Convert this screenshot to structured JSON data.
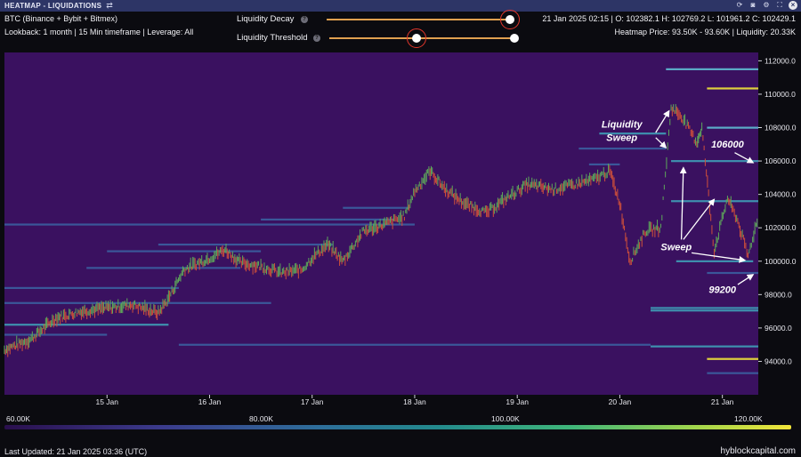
{
  "window": {
    "title": "HEATMAP - LIQUIDATIONS",
    "icons": [
      "swap-icon",
      "refresh-icon",
      "camera-icon",
      "settings-icon",
      "fullscreen-icon",
      "close-icon"
    ]
  },
  "header": {
    "exchange": "BTC (Binance + Bybit + Bitmex)",
    "lookback": "Lookback: 1 month | 15 Min timeframe | Leverage: All",
    "ohlc": "21 Jan 2025 02:15 | O: 102382.1 H: 102769.2 L: 101961.2 C: 102429.1",
    "heatmap_info": "Heatmap Price: 93.50K - 93.60K | Liquidity: 20.33K"
  },
  "controls": {
    "decay_label": "Liquidity Decay",
    "threshold_label": "Liquidity Threshold",
    "decay_value": 0.98,
    "threshold_range": [
      0.48,
      1.0
    ],
    "accent": "#e0a050",
    "highlight": "#e5372b"
  },
  "chart_data": {
    "type": "heatmap",
    "x_ticks": [
      "15 Jan",
      "16 Jan",
      "17 Jan",
      "18 Jan",
      "19 Jan",
      "20 Jan",
      "21 Jan"
    ],
    "y_ticks": [
      94000,
      96000,
      98000,
      100000,
      102000,
      104000,
      106000,
      108000,
      110000,
      112000
    ],
    "y_tick_labels": [
      "94000.0",
      "96000.0",
      "98000.0",
      "100000.0",
      "102000.0",
      "104000.0",
      "106000.0",
      "108000.0",
      "110000.0",
      "112000.0"
    ],
    "ylim": [
      92000,
      112500
    ],
    "background": "#3a1160",
    "price_path": [
      [
        14.0,
        94700
      ],
      [
        14.25,
        95300
      ],
      [
        14.5,
        96600
      ],
      [
        14.75,
        97000
      ],
      [
        15.0,
        97200
      ],
      [
        15.25,
        97400
      ],
      [
        15.5,
        96900
      ],
      [
        15.6,
        97800
      ],
      [
        15.75,
        99500
      ],
      [
        16.0,
        100200
      ],
      [
        16.15,
        100700
      ],
      [
        16.3,
        99900
      ],
      [
        16.5,
        99700
      ],
      [
        16.7,
        99300
      ],
      [
        16.9,
        99500
      ],
      [
        17.0,
        100200
      ],
      [
        17.15,
        101000
      ],
      [
        17.3,
        100000
      ],
      [
        17.5,
        101800
      ],
      [
        17.75,
        102300
      ],
      [
        17.9,
        102700
      ],
      [
        18.0,
        104200
      ],
      [
        18.15,
        105400
      ],
      [
        18.3,
        104300
      ],
      [
        18.5,
        103400
      ],
      [
        18.7,
        102900
      ],
      [
        18.9,
        103800
      ],
      [
        19.1,
        104600
      ],
      [
        19.35,
        104300
      ],
      [
        19.5,
        104500
      ],
      [
        19.75,
        104900
      ],
      [
        19.9,
        105400
      ],
      [
        20.0,
        103500
      ],
      [
        20.1,
        100000
      ],
      [
        20.25,
        101800
      ],
      [
        20.4,
        102000
      ],
      [
        20.5,
        109200
      ],
      [
        20.6,
        108700
      ],
      [
        20.75,
        107100
      ],
      [
        20.8,
        108000
      ],
      [
        20.92,
        100600
      ],
      [
        21.05,
        103800
      ],
      [
        21.15,
        102400
      ],
      [
        21.25,
        100300
      ],
      [
        21.35,
        102700
      ]
    ],
    "liquidity_levels": [
      {
        "price": 111500,
        "from": 20.45,
        "to": 21.35,
        "intensity": 0.55
      },
      {
        "price": 110350,
        "from": 20.85,
        "to": 21.35,
        "intensity": 1.0
      },
      {
        "price": 108000,
        "from": 20.85,
        "to": 21.35,
        "intensity": 0.55
      },
      {
        "price": 107650,
        "from": 19.8,
        "to": 20.45,
        "intensity": 0.4
      },
      {
        "price": 106750,
        "from": 19.6,
        "to": 20.45,
        "intensity": 0.35
      },
      {
        "price": 106000,
        "from": 20.5,
        "to": 21.35,
        "intensity": 0.45
      },
      {
        "price": 105800,
        "from": 19.7,
        "to": 20.0,
        "intensity": 0.35
      },
      {
        "price": 103600,
        "from": 20.5,
        "to": 21.35,
        "intensity": 0.4
      },
      {
        "price": 102200,
        "from": 14.0,
        "to": 18.0,
        "intensity": 0.3
      },
      {
        "price": 102500,
        "from": 16.5,
        "to": 17.8,
        "intensity": 0.3
      },
      {
        "price": 103200,
        "from": 17.3,
        "to": 17.95,
        "intensity": 0.3
      },
      {
        "price": 101000,
        "from": 15.5,
        "to": 17.2,
        "intensity": 0.3
      },
      {
        "price": 100600,
        "from": 15.0,
        "to": 16.5,
        "intensity": 0.35
      },
      {
        "price": 99600,
        "from": 14.8,
        "to": 16.3,
        "intensity": 0.3
      },
      {
        "price": 100000,
        "from": 20.55,
        "to": 21.3,
        "intensity": 0.4
      },
      {
        "price": 99300,
        "from": 20.85,
        "to": 21.35,
        "intensity": 0.3
      },
      {
        "price": 98400,
        "from": 14.0,
        "to": 15.7,
        "intensity": 0.3
      },
      {
        "price": 97500,
        "from": 14.0,
        "to": 16.6,
        "intensity": 0.3
      },
      {
        "price": 97200,
        "from": 20.3,
        "to": 21.35,
        "intensity": 0.4
      },
      {
        "price": 97050,
        "from": 20.3,
        "to": 21.35,
        "intensity": 0.45
      },
      {
        "price": 96200,
        "from": 14.0,
        "to": 15.6,
        "intensity": 0.45
      },
      {
        "price": 95600,
        "from": 14.0,
        "to": 15.0,
        "intensity": 0.3
      },
      {
        "price": 95000,
        "from": 15.7,
        "to": 20.3,
        "intensity": 0.3
      },
      {
        "price": 94900,
        "from": 20.3,
        "to": 21.35,
        "intensity": 0.45
      },
      {
        "price": 94150,
        "from": 20.85,
        "to": 21.35,
        "intensity": 1.0
      },
      {
        "price": 93300,
        "from": 20.85,
        "to": 21.35,
        "intensity": 0.3
      }
    ],
    "annotations": [
      {
        "text": "Liquidity",
        "x": 20.02,
        "y": 108000
      },
      {
        "text": "Sweep",
        "x": 20.02,
        "y": 107200
      },
      {
        "text": "106000",
        "x": 21.05,
        "y": 106800
      },
      {
        "text": "Sweep",
        "x": 20.55,
        "y": 100650
      },
      {
        "text": "99200",
        "x": 21.0,
        "y": 98100
      }
    ],
    "colorbar_ticks": [
      "60.00K",
      "80.00K",
      "100.00K",
      "120.00K"
    ]
  },
  "footer": {
    "last_updated": "Last Updated: 21 Jan 2025 03:36 (UTC)",
    "brand": "hyblockcapital.com"
  }
}
